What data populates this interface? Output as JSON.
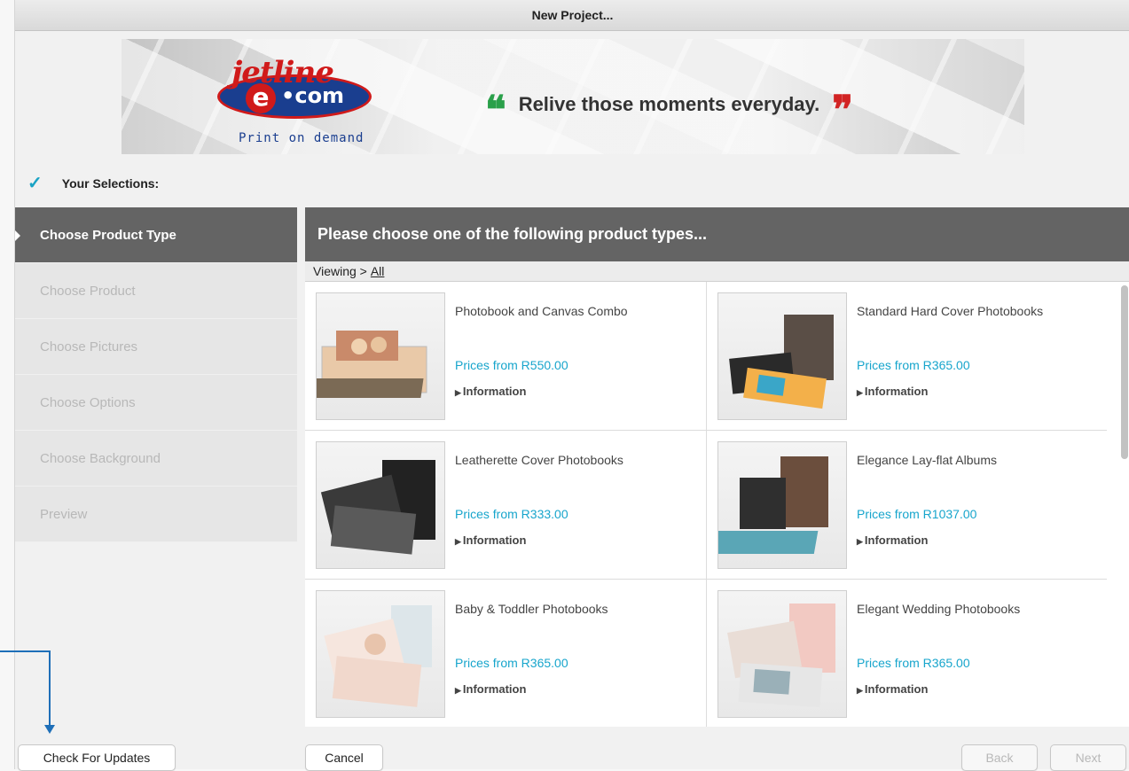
{
  "window": {
    "title": "New Project..."
  },
  "banner": {
    "logo_top": "jetline",
    "logo_e": "e",
    "logo_com": "•com",
    "logo_sub": "Print on demand",
    "tagline": "Relive those moments everyday.",
    "quote_open": "❝",
    "quote_close": "❞"
  },
  "selections": {
    "check": "✓",
    "label": "Your Selections:"
  },
  "steps": [
    {
      "label": "Choose Product Type",
      "active": true
    },
    {
      "label": "Choose Product",
      "active": false
    },
    {
      "label": "Choose Pictures",
      "active": false
    },
    {
      "label": "Choose Options",
      "active": false
    },
    {
      "label": "Choose Background",
      "active": false
    },
    {
      "label": "Preview",
      "active": false
    }
  ],
  "content": {
    "header": "Please choose one of the following product types...",
    "viewing_prefix": "Viewing >",
    "viewing_link": "All"
  },
  "products": [
    {
      "title": "Photobook and Canvas Combo",
      "price": "Prices from R550.00",
      "info": "Information"
    },
    {
      "title": "Standard Hard Cover Photobooks",
      "price": "Prices from R365.00",
      "info": "Information"
    },
    {
      "title": "Leatherette Cover Photobooks",
      "price": "Prices from R333.00",
      "info": "Information"
    },
    {
      "title": "Elegance Lay-flat Albums",
      "price": "Prices from R1037.00",
      "info": "Information"
    },
    {
      "title": "Baby & Toddler Photobooks",
      "price": "Prices from R365.00",
      "info": "Information"
    },
    {
      "title": "Elegant Wedding Photobooks",
      "price": "Prices from R365.00",
      "info": "Information"
    }
  ],
  "buttons": {
    "check_updates": "Check For Updates",
    "cancel": "Cancel",
    "back": "Back",
    "next": "Next"
  },
  "colors": {
    "accent": "#17a5cc",
    "header_bg": "#646464",
    "annotation": "#1e6fb8"
  }
}
